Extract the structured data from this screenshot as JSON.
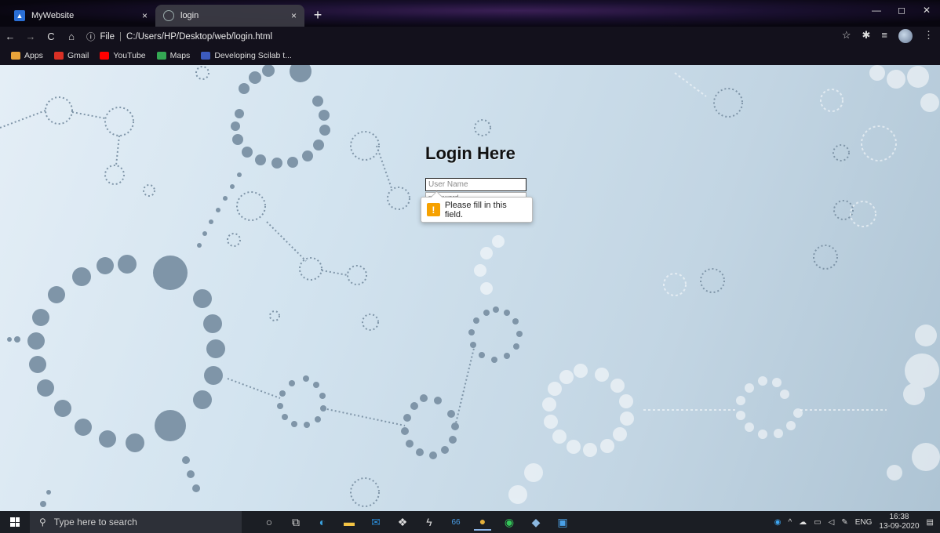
{
  "tabs": [
    {
      "title": "MyWebsite",
      "close": "×"
    },
    {
      "title": "login",
      "close": "×"
    }
  ],
  "new_tab": "+",
  "window_controls": {
    "minimize": "—",
    "maximize": "◻",
    "close": "✕"
  },
  "address_bar": {
    "protocol_label": "File",
    "separator": "|",
    "url": "C:/Users/HP/Desktop/web/login.html"
  },
  "bookmarks": [
    {
      "label": "Apps",
      "icon": "apps-grid-icon",
      "color": "#e8a33a"
    },
    {
      "label": "Gmail",
      "icon": "gmail-icon",
      "color": "#d93025"
    },
    {
      "label": "YouTube",
      "icon": "youtube-icon",
      "color": "#ff0000"
    },
    {
      "label": "Maps",
      "icon": "maps-icon",
      "color": "#34a853"
    },
    {
      "label": "Developing Scilab t...",
      "icon": "scilab-icon",
      "color": "#3c5bbd"
    }
  ],
  "page": {
    "heading": "Login Here",
    "username_placeholder": "User Name",
    "password_placeholder": "password",
    "validation_message": "Please fill in this field.",
    "validation_icon": "!",
    "warning_color": "#f6a100"
  },
  "taskbar": {
    "search_placeholder": "Type here to search",
    "store_badge": "66",
    "tray_language": "ENG",
    "time": "16:38",
    "date": "13-09-2020"
  }
}
